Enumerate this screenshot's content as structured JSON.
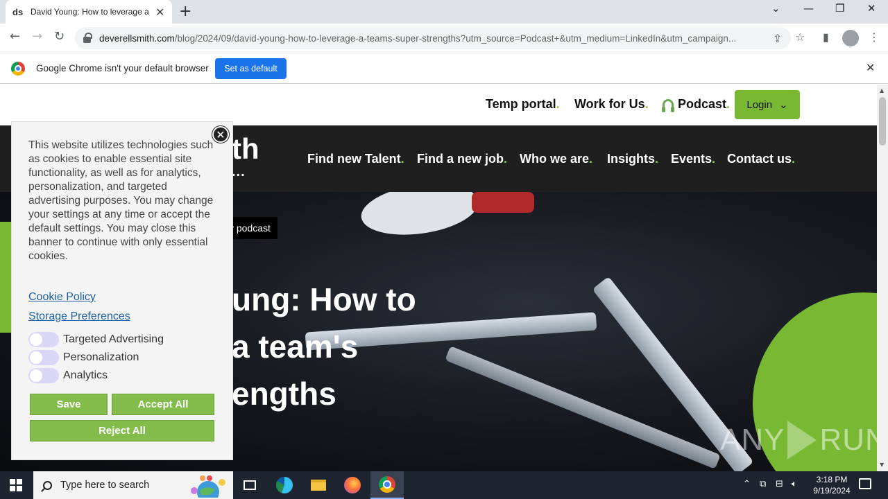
{
  "browser": {
    "tab": {
      "favicon_text": "ds",
      "title": "David Young: How to leverage a team's super strengths"
    },
    "window_controls": [
      "chevron-down",
      "minimize",
      "restore",
      "close"
    ],
    "url_host": "deverellsmith.com",
    "url_path": "/blog/2024/09/david-young-how-to-leverage-a-teams-super-strengths?utm_source=Podcast+&utm_medium=LinkedIn&utm_campaign...",
    "infobar": {
      "message": "Google Chrome isn't your default browser",
      "button_label": "Set as default"
    }
  },
  "site": {
    "top_nav": [
      {
        "label": "Temp portal",
        "dot": "."
      },
      {
        "label": "Work for Us",
        "dot": "."
      },
      {
        "label": "Podcast",
        "dot": "."
      }
    ],
    "login_label": "Login",
    "logo_fragment": "th",
    "logo_dots": "...",
    "main_nav": [
      {
        "label": "Find new Talent",
        "dot": "."
      },
      {
        "label": "Find a new job",
        "dot": "."
      },
      {
        "label": "Who we are",
        "dot": "."
      },
      {
        "label": "Insights",
        "dot": "."
      },
      {
        "label": "Events",
        "dot": "."
      },
      {
        "label": "Contact us",
        "dot": "."
      }
    ],
    "breadcrumb_fragment": "y podcast",
    "hero_title_lines": [
      "ung: How to",
      "a team's",
      "engths"
    ],
    "accent_color": "#78b833"
  },
  "cookie_banner": {
    "text": "This website utilizes technologies such as cookies to enable essential site functionality, as well as for analytics, personalization, and targeted advertising purposes. You may change your settings at any time or accept the default settings. You may close this banner to continue with only essential cookies.",
    "links": [
      "Cookie Policy",
      "Storage Preferences"
    ],
    "toggles": [
      {
        "label": "Targeted Advertising",
        "on": false
      },
      {
        "label": "Personalization",
        "on": false
      },
      {
        "label": "Analytics",
        "on": false
      }
    ],
    "buttons": {
      "save": "Save",
      "accept_all": "Accept All",
      "reject_all": "Reject All"
    }
  },
  "watermark": {
    "left": "ANY",
    "right": "RUN"
  },
  "taskbar": {
    "search_placeholder": "Type here to search",
    "apps": [
      "task-view",
      "edge",
      "file-explorer",
      "firefox",
      "chrome"
    ],
    "active_app": "chrome",
    "time": "3:18 PM",
    "date": "9/19/2024"
  }
}
